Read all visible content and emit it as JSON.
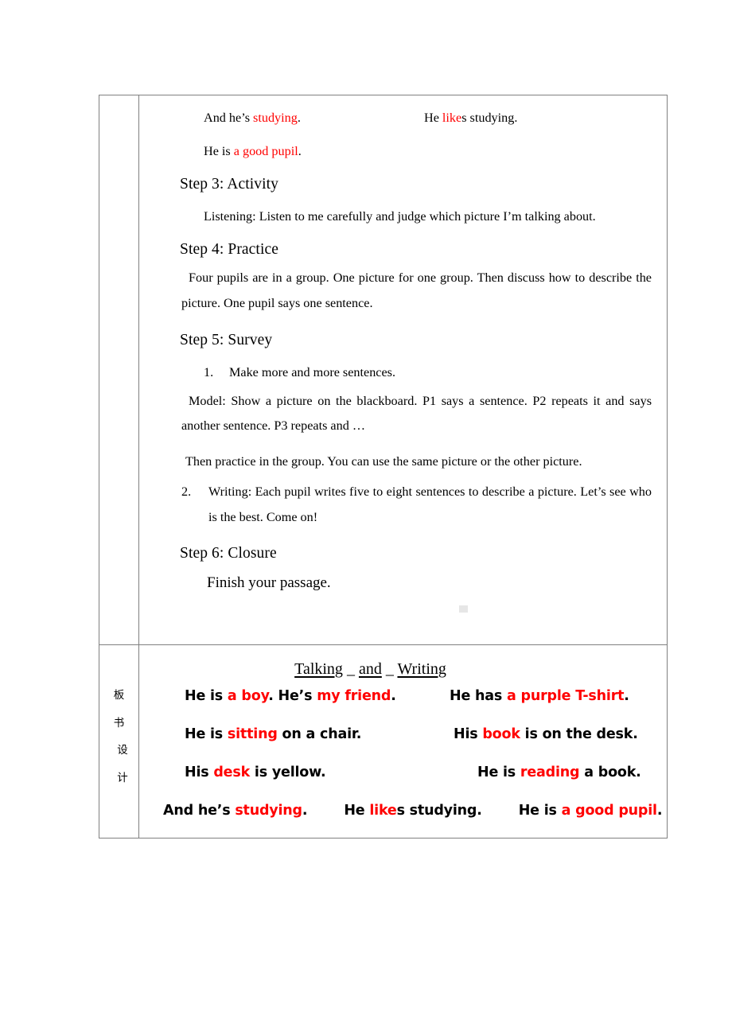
{
  "document": {
    "type": "lesson-plan-table"
  },
  "procedure": {
    "top_lines": [
      {
        "left_plain_a": "And he’s ",
        "left_red": "studying",
        "left_plain_b": ".",
        "right_plain_a": "He ",
        "right_red": "like",
        "right_plain_b": "s studying."
      }
    ],
    "second_line": {
      "plain_a": "He is ",
      "red": "a good pupil",
      "plain_b": "."
    },
    "step3_head": "Step 3: Activity",
    "step3_body": "Listening: Listen to me carefully and judge which picture I’m talking about.",
    "step4_head": "Step 4: Practice",
    "step4_body": "Four pupils are in a group. One picture for one group. Then discuss how to describe the picture. One pupil says one sentence.",
    "step5_head": "Step 5: Survey",
    "step5_item1_num": "1.",
    "step5_item1_text": "Make more and more sentences.",
    "step5_model": "Model: Show a picture on the blackboard. P1 says a sentence. P2 repeats it and says another sentence. P3 repeats and …",
    "step5_then": "Then practice in the group. You can use the same picture or the other picture.",
    "step5_item2_num": "2.",
    "step5_item2_text": "Writing: Each pupil writes five to eight sentences to describe a picture. Let’s see who is the best. Come on!",
    "step6_head": "Step 6: Closure",
    "step6_body": "Finish your passage."
  },
  "blackboard": {
    "label_chars": [
      "板",
      "书",
      "设",
      "计"
    ],
    "title_parts": [
      "Talking",
      " _ ",
      "and",
      " _ ",
      "Writing"
    ],
    "title_full": "Talking _ and _ Writing",
    "rows": [
      {
        "left": {
          "p1": "He is ",
          "r1": "a boy",
          "p2": ". He’s ",
          "r2": "my friend",
          "p3": "."
        },
        "right": {
          "p1": "He has ",
          "r1": "a purple T-shirt",
          "p2": "."
        }
      },
      {
        "left": {
          "p1": "He is ",
          "r1": "sitting",
          "p2": " on a chair.",
          "r2": "",
          "p3": ""
        },
        "right": {
          "p1": "His ",
          "r1": "book",
          "p2": " is on the desk."
        }
      },
      {
        "left": {
          "p1": "His ",
          "r1": "desk",
          "p2": " is yellow.",
          "r2": "",
          "p3": ""
        },
        "right": {
          "p1": "He is ",
          "r1": "reading",
          "p2": " a book."
        }
      }
    ],
    "final_row": {
      "s1_p1": "And he’s ",
      "s1_r": "studying",
      "s1_p2": ".",
      "s2_p1": "He ",
      "s2_r": "like",
      "s2_p2": "s studying.",
      "s3_p1": "He is ",
      "s3_r": "a good pupil",
      "s3_p2": "."
    }
  },
  "colors": {
    "highlight": "#FF0000",
    "text": "#000000",
    "border": "#808080",
    "artifact": "#E6E6E6"
  }
}
